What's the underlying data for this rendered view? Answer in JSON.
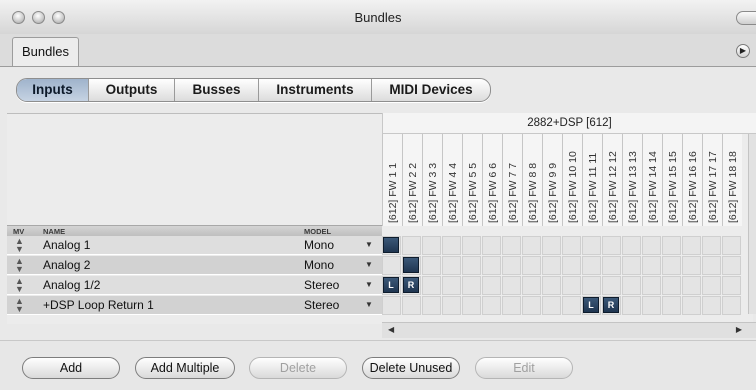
{
  "window": {
    "title": "Bundles"
  },
  "doc_tab": "Bundles",
  "segments": [
    {
      "label": "Inputs",
      "active": true
    },
    {
      "label": "Outputs",
      "active": false
    },
    {
      "label": "Busses",
      "active": false
    },
    {
      "label": "Instruments",
      "active": false
    },
    {
      "label": "MIDI Devices",
      "active": false
    }
  ],
  "device_label": "2882+DSP [612]",
  "channels": [
    "[612] FW 1 1",
    "[612] FW 2 2",
    "[612] FW 3 3",
    "[612] FW 4 4",
    "[612] FW 5 5",
    "[612] FW 6 6",
    "[612] FW 7 7",
    "[612] FW 8 8",
    "[612] FW 9 9",
    "[612] FW 10 10",
    "[612] FW 11 11",
    "[612] FW 12 12",
    "[612] FW 13 13",
    "[612] FW 14 14",
    "[612] FW 15 15",
    "[612] FW 16 16",
    "[612] FW 17 17",
    "[612] FW 18 18"
  ],
  "table_headers": {
    "mv": "MV",
    "name": "NAME",
    "model": "MODEL"
  },
  "rows": [
    {
      "name": "Analog 1",
      "model": "Mono",
      "assign": [
        {
          "col": 0,
          "label": ""
        }
      ]
    },
    {
      "name": "Analog 2",
      "model": "Mono",
      "assign": [
        {
          "col": 1,
          "label": ""
        }
      ]
    },
    {
      "name": "Analog 1/2",
      "model": "Stereo",
      "assign": [
        {
          "col": 0,
          "label": "L"
        },
        {
          "col": 1,
          "label": "R"
        }
      ]
    },
    {
      "name": "+DSP Loop Return 1",
      "model": "Stereo",
      "assign": [
        {
          "col": 10,
          "label": "L"
        },
        {
          "col": 11,
          "label": "R"
        }
      ]
    }
  ],
  "buttons": [
    {
      "label": "Add",
      "enabled": true
    },
    {
      "label": "Add Multiple",
      "enabled": true
    },
    {
      "label": "Delete",
      "enabled": false
    },
    {
      "label": "Delete Unused",
      "enabled": true
    },
    {
      "label": "Edit",
      "enabled": false
    }
  ],
  "icons": {
    "row_reorder": "up-down-arrows-icon",
    "dropdown": "triangle-down-icon",
    "scroll_left": "triangle-left-icon",
    "scroll_right": "triangle-right-icon",
    "panel_menu": "triangle-right-circle-icon"
  },
  "colors": {
    "assign_mark": "#243c5a",
    "active_segment": "#b2c3d8"
  }
}
